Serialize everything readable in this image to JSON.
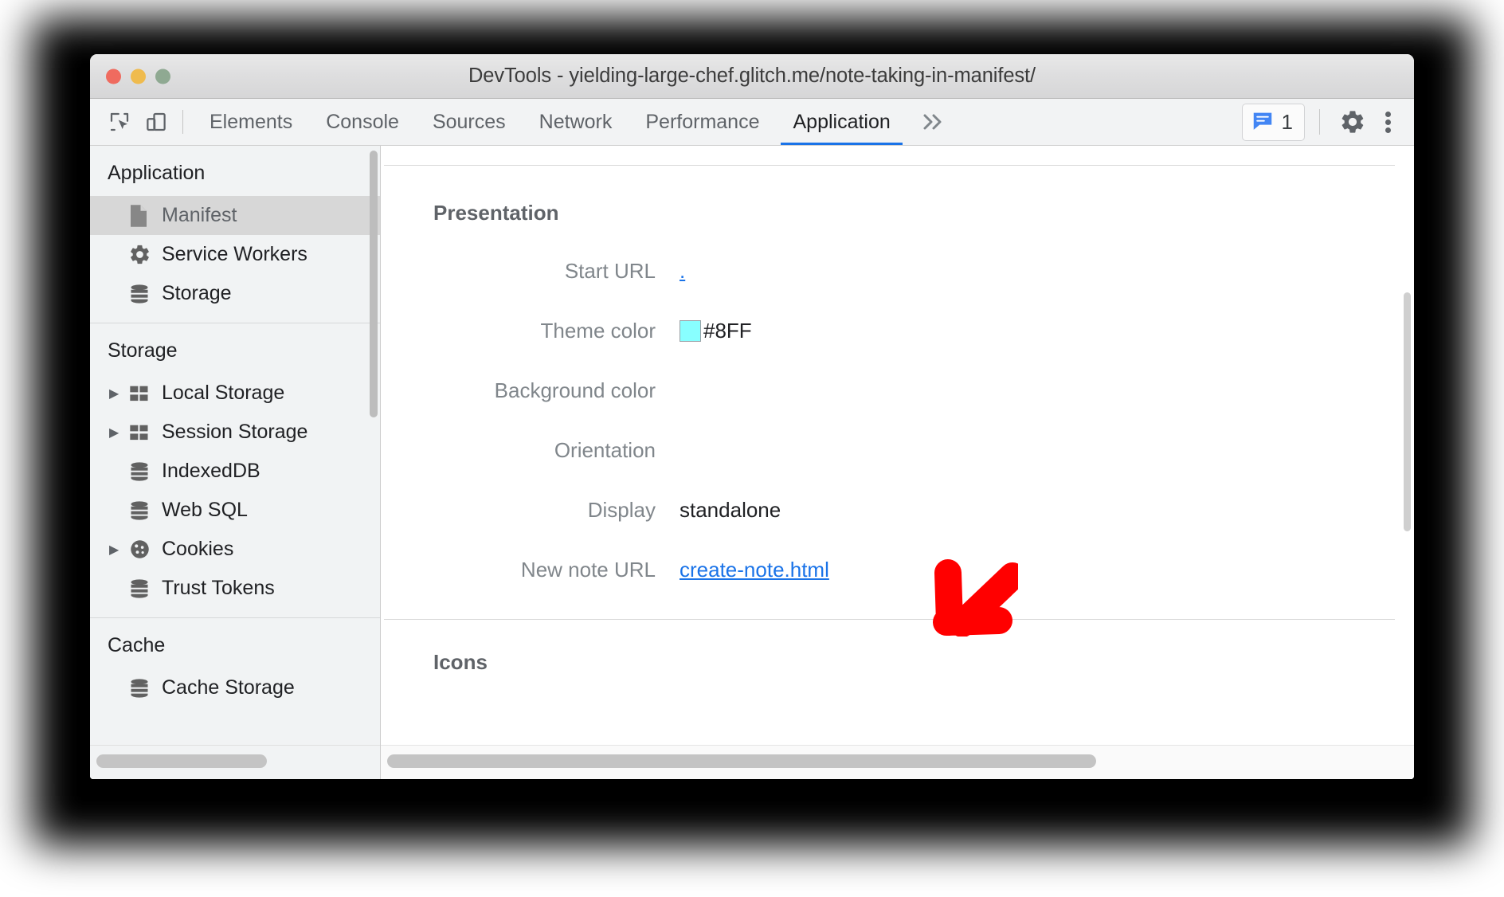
{
  "window": {
    "title": "DevTools - yielding-large-chef.glitch.me/note-taking-in-manifest/"
  },
  "toolbar": {
    "inspect_icon": "inspect-element-icon",
    "device_icon": "device-toolbar-icon",
    "tabs": [
      {
        "label": "Elements",
        "active": false
      },
      {
        "label": "Console",
        "active": false
      },
      {
        "label": "Sources",
        "active": false
      },
      {
        "label": "Network",
        "active": false
      },
      {
        "label": "Performance",
        "active": false
      },
      {
        "label": "Application",
        "active": true
      }
    ],
    "more_tabs_label": "»",
    "message_count": "1",
    "message_icon": "message-bubble-icon",
    "settings_icon": "gear-icon",
    "more_options_icon": "kebab-menu-icon",
    "accent_color": "#1a73e8"
  },
  "sidebar": {
    "sections": [
      {
        "title": "Application",
        "items": [
          {
            "label": "Manifest",
            "icon": "document-icon",
            "selected": true,
            "expandable": false
          },
          {
            "label": "Service Workers",
            "icon": "gear-icon",
            "selected": false,
            "expandable": false
          },
          {
            "label": "Storage",
            "icon": "database-icon",
            "selected": false,
            "expandable": false
          }
        ]
      },
      {
        "title": "Storage",
        "items": [
          {
            "label": "Local Storage",
            "icon": "table-icon",
            "selected": false,
            "expandable": true
          },
          {
            "label": "Session Storage",
            "icon": "table-icon",
            "selected": false,
            "expandable": true
          },
          {
            "label": "IndexedDB",
            "icon": "database-icon",
            "selected": false,
            "expandable": false
          },
          {
            "label": "Web SQL",
            "icon": "database-icon",
            "selected": false,
            "expandable": false
          },
          {
            "label": "Cookies",
            "icon": "cookie-icon",
            "selected": false,
            "expandable": true
          },
          {
            "label": "Trust Tokens",
            "icon": "database-icon",
            "selected": false,
            "expandable": false
          }
        ]
      },
      {
        "title": "Cache",
        "items": [
          {
            "label": "Cache Storage",
            "icon": "database-icon",
            "selected": false,
            "expandable": false
          }
        ]
      }
    ]
  },
  "main": {
    "presentation": {
      "heading": "Presentation",
      "fields": [
        {
          "label": "Start URL",
          "value": ".",
          "type": "link"
        },
        {
          "label": "Theme color",
          "value": "#8FF",
          "type": "color",
          "swatch_color": "#88ffff"
        },
        {
          "label": "Background color",
          "value": "",
          "type": "text"
        },
        {
          "label": "Orientation",
          "value": "",
          "type": "text"
        },
        {
          "label": "Display",
          "value": "standalone",
          "type": "text"
        },
        {
          "label": "New note URL",
          "value": "create-note.html",
          "type": "link"
        }
      ]
    },
    "icons": {
      "heading": "Icons"
    }
  },
  "annotation": {
    "arrow": "red-arrow-pointing-down-left",
    "color": "#ff0000"
  }
}
